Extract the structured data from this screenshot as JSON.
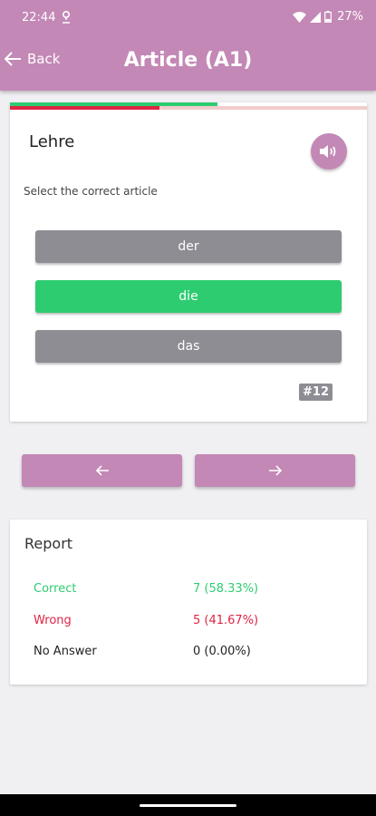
{
  "status": {
    "time": "22:44",
    "battery": "27%"
  },
  "header": {
    "back_label": "Back",
    "title": "Article (A1)"
  },
  "question": {
    "word": "Lehre",
    "instruction": "Select the correct article",
    "options": [
      {
        "label": "der",
        "state": "neutral"
      },
      {
        "label": "die",
        "state": "correct"
      },
      {
        "label": "das",
        "state": "neutral"
      }
    ],
    "number": "#12"
  },
  "progress": {
    "answered_fraction": 0.58,
    "wrong_fraction": 0.42
  },
  "report": {
    "title": "Report",
    "rows": [
      {
        "label": "Correct",
        "value": "7 (58.33%)"
      },
      {
        "label": "Wrong",
        "value": "5 (41.67%)"
      },
      {
        "label": "No Answer",
        "value": "0 (0.00%)"
      }
    ]
  },
  "colors": {
    "accent": "#c388b6",
    "correct": "#2ecc71",
    "wrong": "#e02444",
    "neutral": "#8d8d93"
  }
}
